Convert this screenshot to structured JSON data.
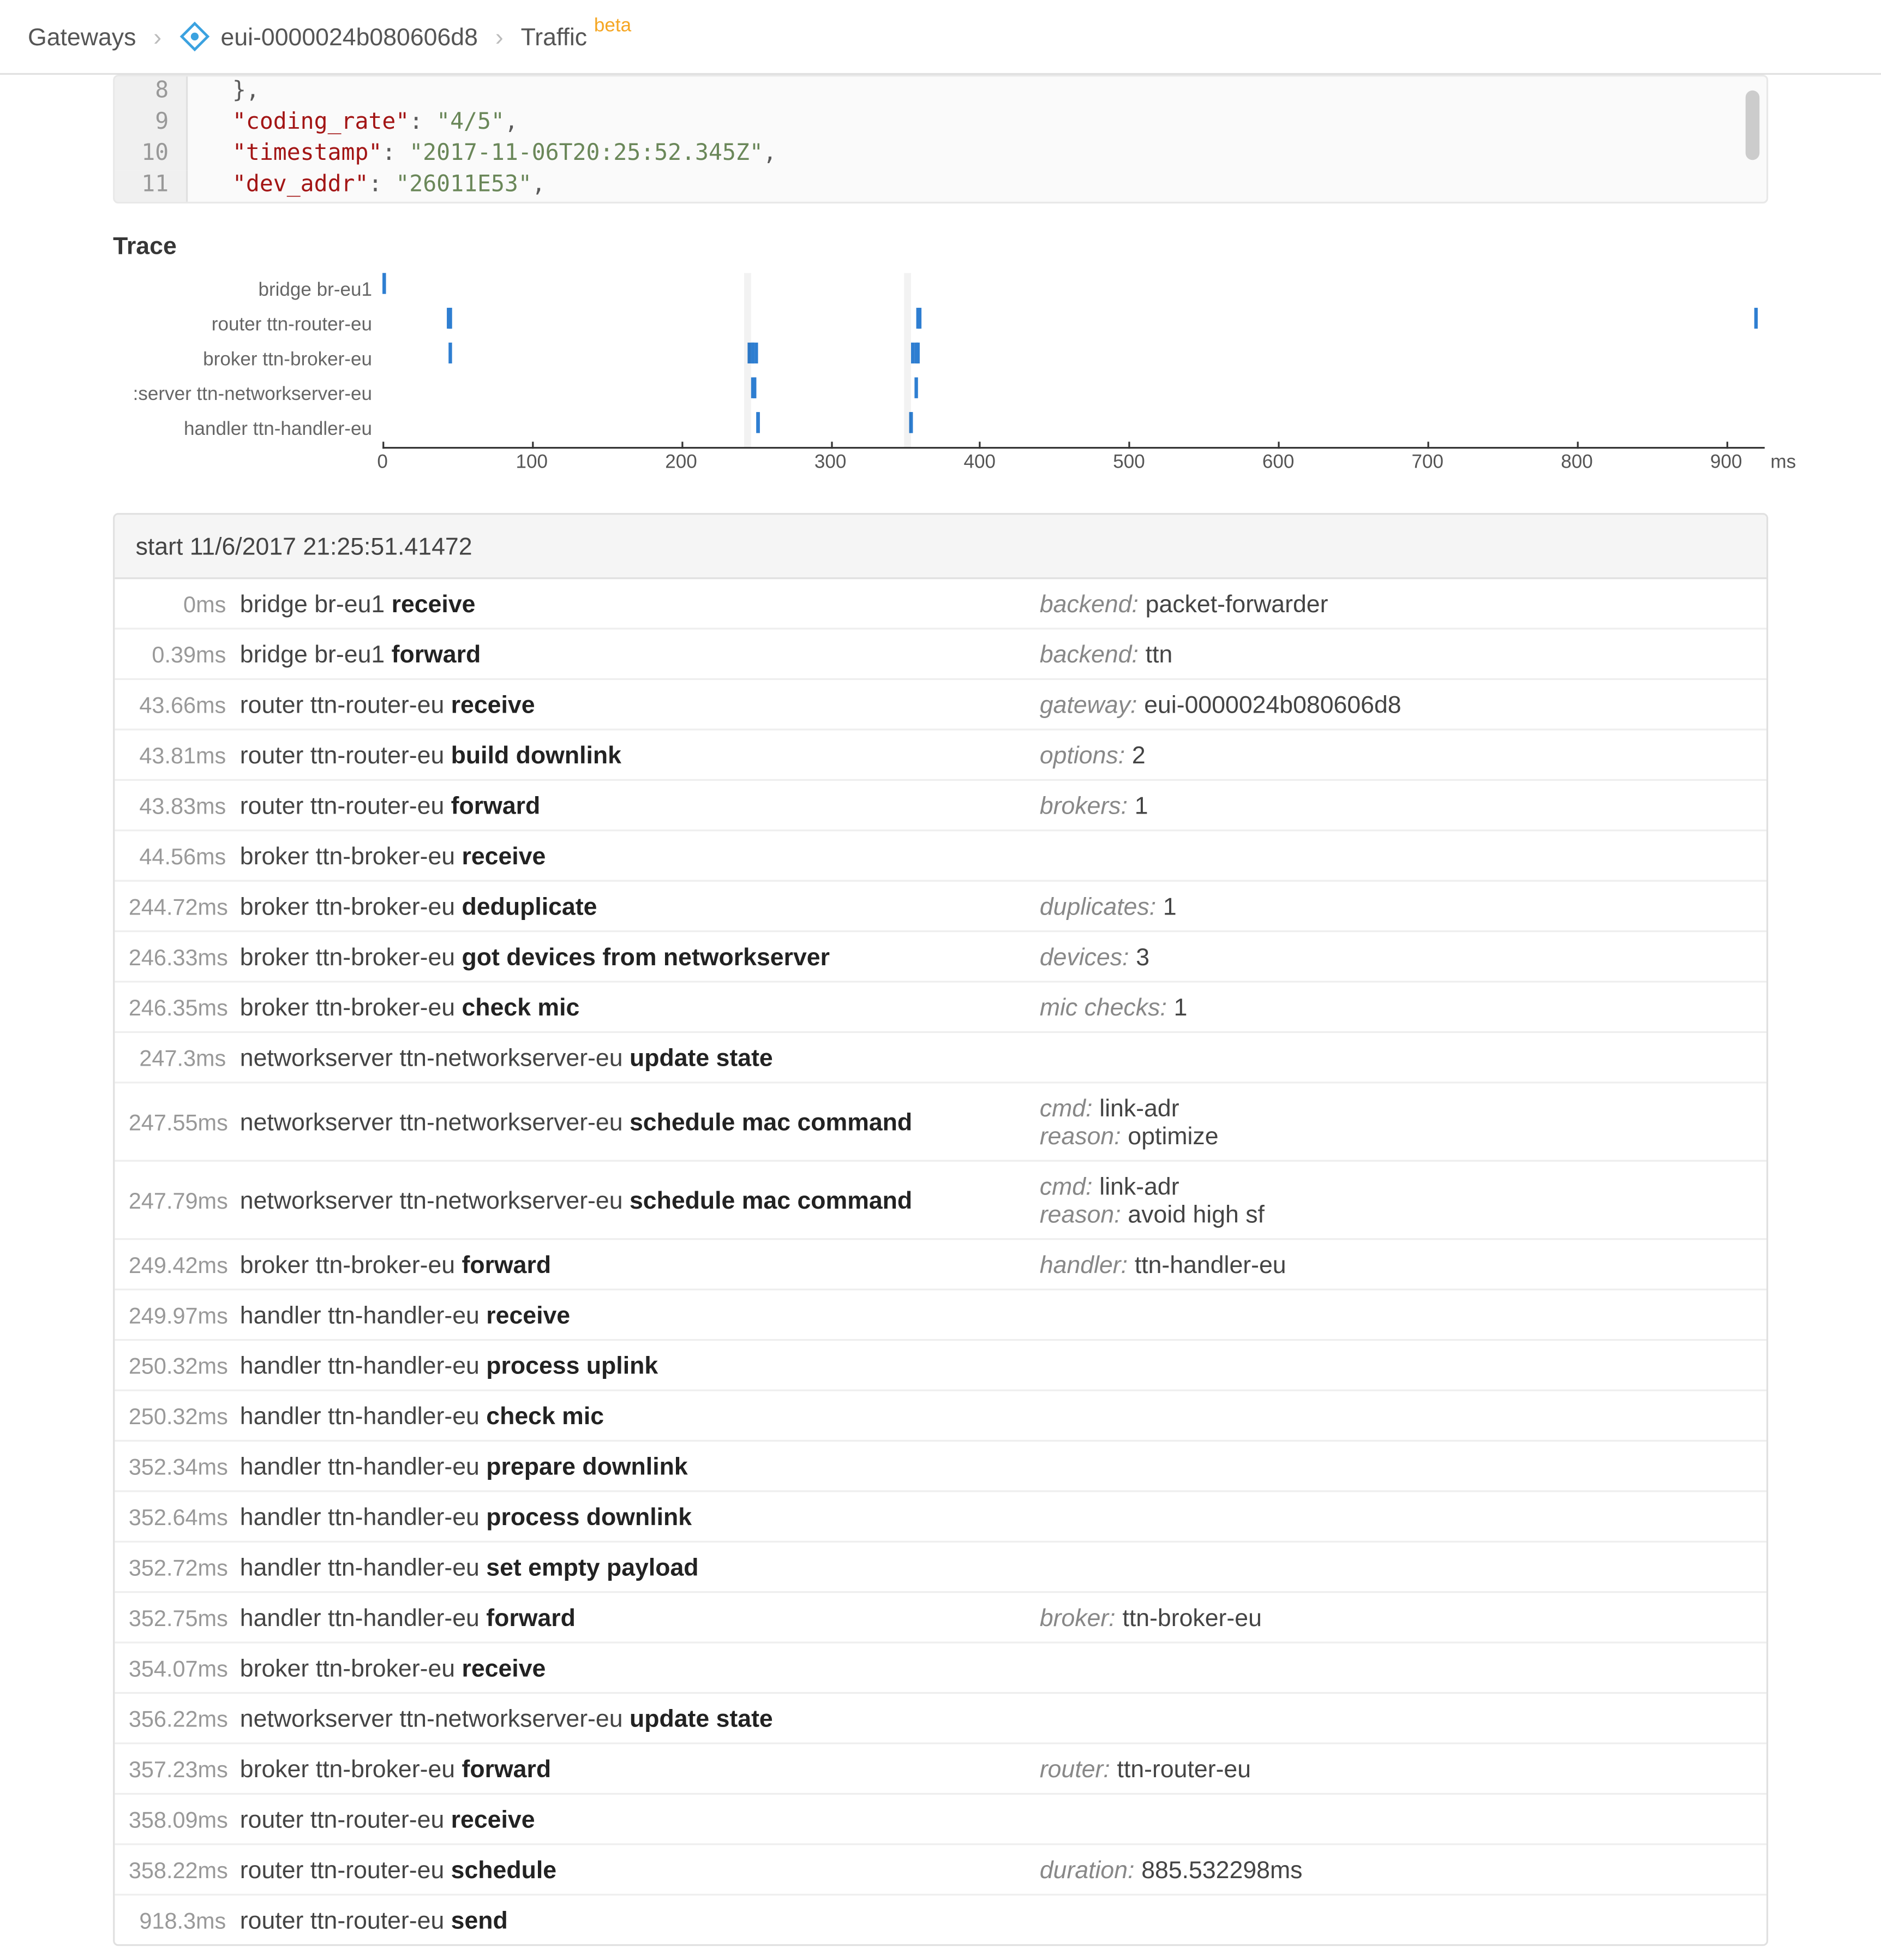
{
  "breadcrumb": {
    "root": "Gateways",
    "gateway": "eui-0000024b080606d8",
    "page": "Traffic",
    "beta": "beta"
  },
  "code": {
    "lines": [
      {
        "n": 8,
        "html": "<span class='tok-brace'>},</span>"
      },
      {
        "n": 9,
        "html": "<span class='tok-key'>\"coding_rate\"</span><span class='tok-punct'>: </span><span class='tok-str'>\"4/5\"</span><span class='tok-punct'>,</span>"
      },
      {
        "n": 10,
        "html": "<span class='tok-key'>\"timestamp\"</span><span class='tok-punct'>: </span><span class='tok-str'>\"2017-11-06T20:25:52.345Z\"</span><span class='tok-punct'>,</span>"
      },
      {
        "n": 11,
        "html": "<span class='tok-key'>\"dev_addr\"</span><span class='tok-punct'>: </span><span class='tok-str'>\"26011E53\"</span><span class='tok-punct'>,</span>"
      }
    ]
  },
  "trace_title": "Trace",
  "chart_data": {
    "type": "scatter",
    "xlabel": "",
    "ylabel": "",
    "xlim": [
      0,
      920
    ],
    "x_unit": "ms",
    "lanes": [
      "bridge br-eu1",
      "router ttn-router-eu",
      "broker ttn-broker-eu",
      "server ttn-networkserver-eu",
      "handler ttn-handler-eu"
    ],
    "lane_label_truncated": {
      "3": ":server ttn-networkserver-eu"
    },
    "ticks": [
      0,
      100,
      200,
      300,
      400,
      500,
      600,
      700,
      800,
      900
    ],
    "gridbands_x": [
      244,
      352
    ],
    "series": [
      {
        "lane": 0,
        "x": [
          0,
          0.39
        ]
      },
      {
        "lane": 1,
        "x": [
          43.66,
          43.81,
          43.83,
          358.09,
          358.22,
          918.3
        ]
      },
      {
        "lane": 2,
        "x": [
          44.56,
          244.72,
          246.33,
          246.35,
          249.42,
          354.07,
          356.22,
          357.23
        ]
      },
      {
        "lane": 3,
        "x": [
          247.3,
          247.55,
          247.79,
          356.22
        ]
      },
      {
        "lane": 4,
        "x": [
          249.97,
          250.32,
          250.32,
          352.34,
          352.64,
          352.72,
          352.75
        ]
      }
    ]
  },
  "trace": {
    "start_label": "start",
    "start_time": "11/6/2017 21:25:51.41472",
    "rows": [
      {
        "t": "0ms",
        "svc": "bridge br-eu1",
        "act": "receive",
        "meta": [
          [
            "backend",
            "packet-forwarder"
          ]
        ]
      },
      {
        "t": "0.39ms",
        "svc": "bridge br-eu1",
        "act": "forward",
        "meta": [
          [
            "backend",
            "ttn"
          ]
        ]
      },
      {
        "t": "43.66ms",
        "svc": "router ttn-router-eu",
        "act": "receive",
        "meta": [
          [
            "gateway",
            "eui-0000024b080606d8"
          ]
        ]
      },
      {
        "t": "43.81ms",
        "svc": "router ttn-router-eu",
        "act": "build downlink",
        "meta": [
          [
            "options",
            "2"
          ]
        ]
      },
      {
        "t": "43.83ms",
        "svc": "router ttn-router-eu",
        "act": "forward",
        "meta": [
          [
            "brokers",
            "1"
          ]
        ]
      },
      {
        "t": "44.56ms",
        "svc": "broker ttn-broker-eu",
        "act": "receive",
        "meta": []
      },
      {
        "t": "244.72ms",
        "svc": "broker ttn-broker-eu",
        "act": "deduplicate",
        "meta": [
          [
            "duplicates",
            "1"
          ]
        ]
      },
      {
        "t": "246.33ms",
        "svc": "broker ttn-broker-eu",
        "act": "got devices from networkserver",
        "meta": [
          [
            "devices",
            "3"
          ]
        ]
      },
      {
        "t": "246.35ms",
        "svc": "broker ttn-broker-eu",
        "act": "check mic",
        "meta": [
          [
            "mic checks",
            "1"
          ]
        ]
      },
      {
        "t": "247.3ms",
        "svc": "networkserver ttn-networkserver-eu",
        "act": "update state",
        "meta": []
      },
      {
        "t": "247.55ms",
        "svc": "networkserver ttn-networkserver-eu",
        "act": "schedule mac command",
        "meta": [
          [
            "cmd",
            "link-adr"
          ],
          [
            "reason",
            "optimize"
          ]
        ]
      },
      {
        "t": "247.79ms",
        "svc": "networkserver ttn-networkserver-eu",
        "act": "schedule mac command",
        "meta": [
          [
            "cmd",
            "link-adr"
          ],
          [
            "reason",
            "avoid high sf"
          ]
        ]
      },
      {
        "t": "249.42ms",
        "svc": "broker ttn-broker-eu",
        "act": "forward",
        "meta": [
          [
            "handler",
            "ttn-handler-eu"
          ]
        ]
      },
      {
        "t": "249.97ms",
        "svc": "handler ttn-handler-eu",
        "act": "receive",
        "meta": []
      },
      {
        "t": "250.32ms",
        "svc": "handler ttn-handler-eu",
        "act": "process uplink",
        "meta": []
      },
      {
        "t": "250.32ms",
        "svc": "handler ttn-handler-eu",
        "act": "check mic",
        "meta": []
      },
      {
        "t": "352.34ms",
        "svc": "handler ttn-handler-eu",
        "act": "prepare downlink",
        "meta": []
      },
      {
        "t": "352.64ms",
        "svc": "handler ttn-handler-eu",
        "act": "process downlink",
        "meta": []
      },
      {
        "t": "352.72ms",
        "svc": "handler ttn-handler-eu",
        "act": "set empty payload",
        "meta": []
      },
      {
        "t": "352.75ms",
        "svc": "handler ttn-handler-eu",
        "act": "forward",
        "meta": [
          [
            "broker",
            "ttn-broker-eu"
          ]
        ]
      },
      {
        "t": "354.07ms",
        "svc": "broker ttn-broker-eu",
        "act": "receive",
        "meta": []
      },
      {
        "t": "356.22ms",
        "svc": "networkserver ttn-networkserver-eu",
        "act": "update state",
        "meta": []
      },
      {
        "t": "357.23ms",
        "svc": "broker ttn-broker-eu",
        "act": "forward",
        "meta": [
          [
            "router",
            "ttn-router-eu"
          ]
        ]
      },
      {
        "t": "358.09ms",
        "svc": "router ttn-router-eu",
        "act": "receive",
        "meta": []
      },
      {
        "t": "358.22ms",
        "svc": "router ttn-router-eu",
        "act": "schedule",
        "meta": [
          [
            "duration",
            "885.532298ms"
          ]
        ]
      },
      {
        "t": "918.3ms",
        "svc": "router ttn-router-eu",
        "act": "send",
        "meta": []
      }
    ]
  }
}
